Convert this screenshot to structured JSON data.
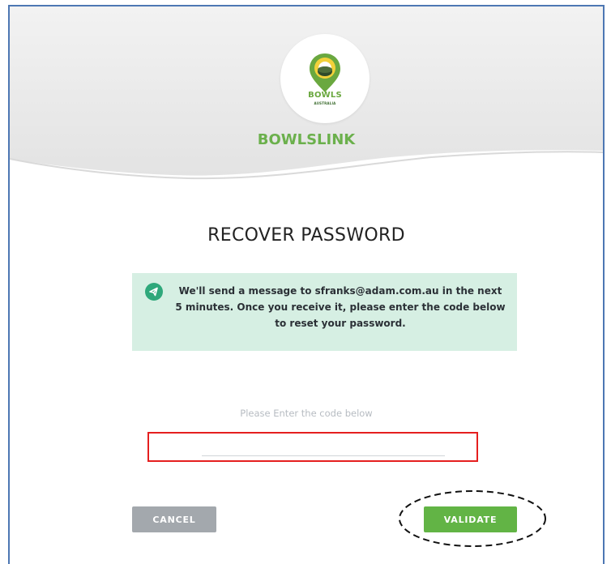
{
  "brand": {
    "logo_word": "BOWLS",
    "logo_sub": "AUSTRALIA",
    "name": "BOWLSLINK"
  },
  "page": {
    "title": "RECOVER PASSWORD"
  },
  "info": {
    "message": "We'll send a message to sfranks@adam.com.au in the next 5 minutes. Once you receive it, please enter the code below to reset your password.",
    "icon": "send-icon"
  },
  "code": {
    "label": "Please Enter the code below",
    "value": "",
    "placeholder": ""
  },
  "actions": {
    "cancel_label": "CANCEL",
    "validate_label": "VALIDATE"
  },
  "colors": {
    "brand_green": "#6bb04c",
    "button_green": "#62b445",
    "button_grey": "#a3a8ad",
    "info_bg": "#d6efe3",
    "info_icon": "#2fa87b",
    "highlight_red": "#e51f1f",
    "frame_blue": "#4d77b3"
  }
}
